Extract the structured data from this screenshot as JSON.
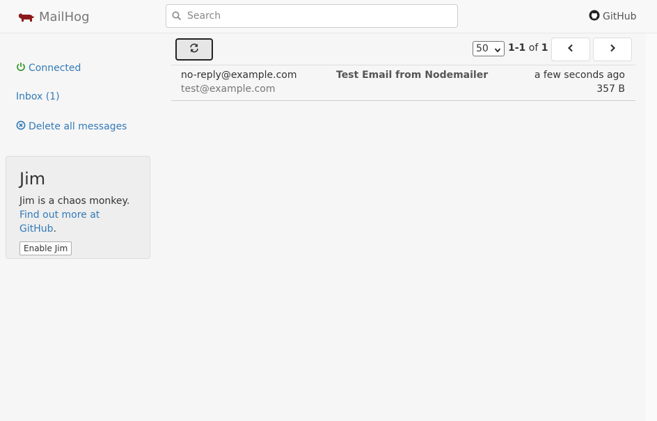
{
  "header": {
    "brand": "MailHog",
    "search_placeholder": "Search",
    "github_label": "GitHub"
  },
  "sidebar": {
    "connected": "Connected",
    "inbox": "Inbox (1)",
    "delete_all": "Delete all messages",
    "jim": {
      "title": "Jim",
      "description": "Jim is a chaos monkey.",
      "link": "Find out more at GitHub",
      "link_suffix": ".",
      "button": "Enable Jim"
    }
  },
  "toolbar": {
    "per_page": "50",
    "range": "1-1",
    "of": "of",
    "total": "1"
  },
  "messages": [
    {
      "from": "no-reply@example.com",
      "to": "test@example.com",
      "subject": "Test Email from Nodemailer",
      "time": "a few seconds ago",
      "size": "357 B"
    }
  ],
  "colors": {
    "link": "#337ab7",
    "connected": "#3c9a2f",
    "brand_icon": "#8b1a1a"
  }
}
